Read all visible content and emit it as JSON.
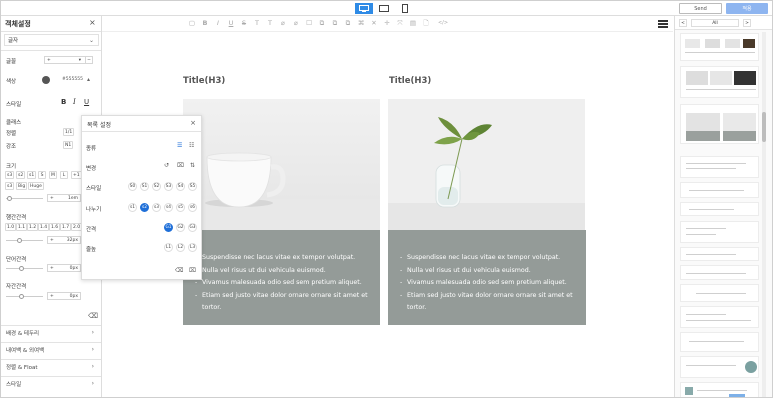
{
  "top": {
    "devices": [
      "desktop-icon",
      "tablet-icon",
      "mobile-icon"
    ],
    "send_label": "Send",
    "publish_label": "적용"
  },
  "left": {
    "title": "객체설정",
    "close": "×",
    "font_select": "글자",
    "rows": {
      "font_label": "글꼴",
      "color_label": "색상",
      "color_value": "#555555",
      "style_label": "스타일",
      "bold": "B",
      "italic": "I",
      "underline": "U",
      "class_label": "클래스",
      "align_label": "정렬",
      "align_value": "1/1",
      "emph_label": "강조",
      "emph_value": "N1",
      "size_label": "크기",
      "size_buttons": [
        "s3",
        "s2",
        "s1",
        "S",
        "M",
        "L",
        "+1"
      ],
      "size_buttons2": [
        "s3",
        "Big",
        "Huge"
      ],
      "size_value": "1em",
      "lh_label": "행간간격",
      "lh_buttons": [
        "1.0",
        "1.1",
        "1.2",
        "1.4",
        "1.6",
        "1.7",
        "2.0"
      ],
      "lh_value": "32px",
      "ls_label": "단어간격",
      "ls_value": "0px",
      "ws_label": "자간간격",
      "ws_value": "0px"
    },
    "sections": [
      "배경 & 테두리",
      "내여백 & 외여백",
      "정렬 & Float",
      "스타일"
    ]
  },
  "toolbar": {
    "items": [
      "▢",
      "B",
      "I",
      "U",
      "S",
      "T",
      "T",
      "⌀",
      "⌀",
      "☐",
      "⧉",
      "⧉",
      "⧉",
      "⌘",
      "✕",
      "✛",
      "⤧",
      "▤",
      "🗋",
      "</>"
    ]
  },
  "canvas": {
    "cards": [
      {
        "title": "Title(H3)",
        "items": [
          "Suspendisse nec lacus vitae ex tempor volutpat.",
          "Nulla vel risus ut dui vehicula euismod.",
          "Vivamus malesuada odio sed sem pretium aliquet.",
          "Etiam sed justo vitae dolor ornare ornare sit amet et tortor."
        ]
      },
      {
        "title": "Title(H3)",
        "items": [
          "Suspendisse nec lacus vitae ex tempor volutpat.",
          "Nulla vel risus ut dui vehicula euismod.",
          "Vivamus malesuada odio sed sem pretium aliquet.",
          "Etiam sed justo vitae dolor ornare ornare sit amet et tortor."
        ]
      }
    ]
  },
  "popup": {
    "title": "목록 설정",
    "close": "×",
    "type_label": "종류",
    "change_label": "변경",
    "style_label": "스타일",
    "style_buttons": [
      "S0",
      "S1",
      "S2",
      "S3",
      "S4",
      "S5"
    ],
    "divider_label": "나누기",
    "divider_buttons": [
      "s1",
      "s2",
      "s3",
      "s4",
      "s5",
      "s6"
    ],
    "spacing_label": "간격",
    "spacing_buttons": [
      "G1",
      "G2",
      "G3"
    ],
    "line_label": "줄높",
    "line_buttons": [
      "L1",
      "L2",
      "L3"
    ]
  },
  "right": {
    "page_prev": "<",
    "page_value": "All",
    "page_next": ">"
  },
  "colors": {
    "accent": "#2f8be6",
    "card_body": "#949b98",
    "selected": "#1f6fd8"
  }
}
